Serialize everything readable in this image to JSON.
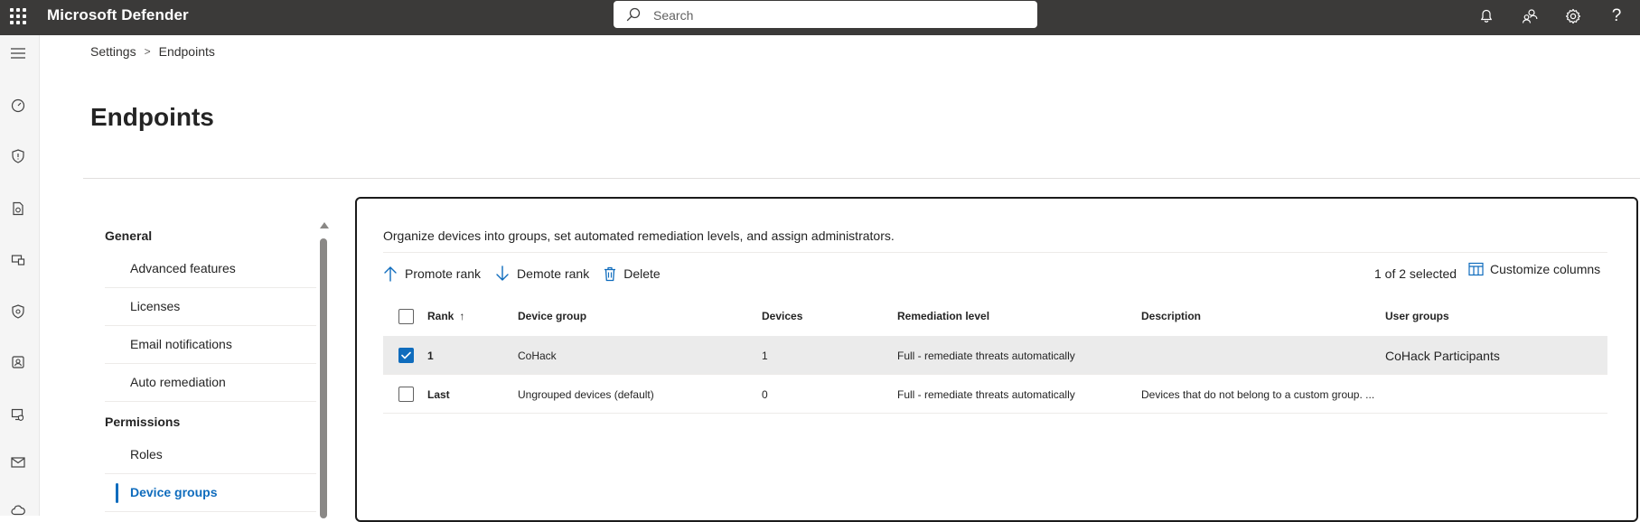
{
  "app": {
    "title": "Microsoft Defender"
  },
  "search": {
    "placeholder": "Search"
  },
  "breadcrumb": {
    "items": [
      "Settings",
      "Endpoints"
    ]
  },
  "page": {
    "title": "Endpoints"
  },
  "nav": {
    "groups": [
      "General",
      "Permissions"
    ],
    "general_items": [
      "Advanced features",
      "Licenses",
      "Email notifications",
      "Auto remediation"
    ],
    "permissions_items": [
      "Roles",
      "Device groups"
    ],
    "active": "Device groups"
  },
  "content": {
    "description": "Organize devices into groups, set automated remediation levels, and assign administrators.",
    "commands": {
      "promote": "Promote rank",
      "demote": "Demote rank",
      "delete": "Delete"
    },
    "selection": "1 of 2 selected",
    "customize": "Customize columns"
  },
  "table": {
    "headers": {
      "rank": "Rank",
      "rank_sort": "↑",
      "device_group": "Device group",
      "devices": "Devices",
      "remediation": "Remediation level",
      "description": "Description",
      "user_groups": "User groups"
    },
    "rows": [
      {
        "selected": true,
        "rank": "1",
        "device_group": "CoHack",
        "devices": "1",
        "remediation": "Full - remediate threats automatically",
        "description": "",
        "user_groups": "CoHack Participants"
      },
      {
        "selected": false,
        "rank": "Last",
        "device_group": "Ungrouped devices (default)",
        "devices": "0",
        "remediation": "Full - remediate threats automatically",
        "description": "Devices that do not belong to a custom group. ...",
        "user_groups": ""
      }
    ]
  },
  "colors": {
    "topbar": "#3b3a39",
    "accent": "#0f6cbd",
    "selected_row": "#ebebeb"
  },
  "icons": [
    "waffle-icon",
    "search-icon",
    "bell-icon",
    "people-icon",
    "gear-icon",
    "help-icon",
    "hamburger-icon",
    "arrow-up-icon",
    "arrow-down-icon",
    "trash-icon",
    "customize-columns-icon"
  ]
}
